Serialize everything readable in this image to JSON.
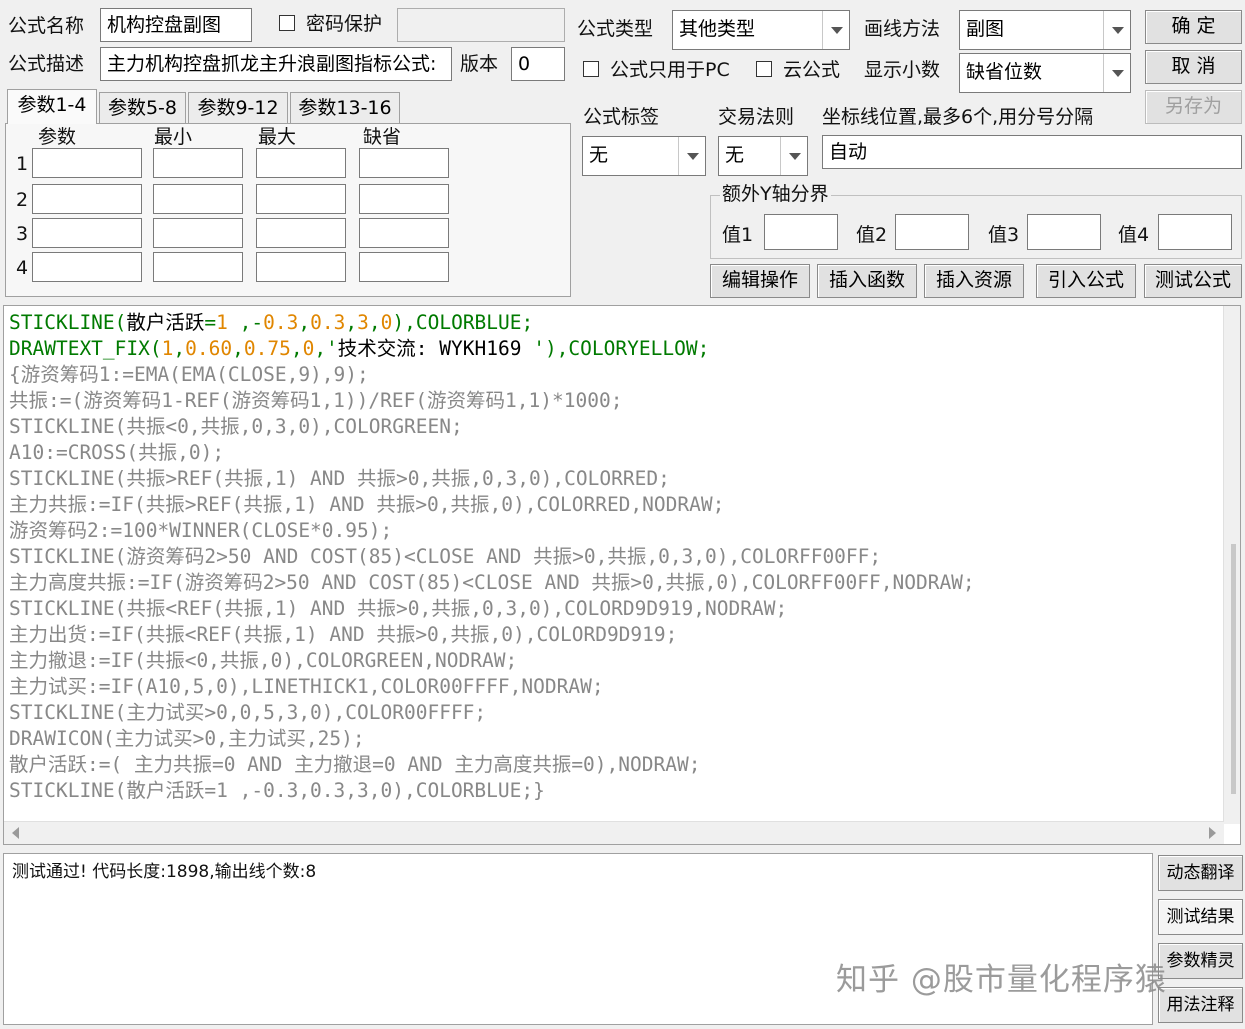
{
  "header": {
    "name_label": "公式名称",
    "name_value": "机构控盘副图",
    "password_label": "密码保护",
    "desc_label": "公式描述",
    "desc_value": "主力机构控盘抓龙主升浪副图指标公式:",
    "version_label": "版本",
    "version_value": "0",
    "type_label": "公式类型",
    "type_value": "其他类型",
    "draw_label": "画线方法",
    "draw_value": "副图",
    "pc_only_label": "公式只用于PC",
    "cloud_label": "云公式",
    "decimals_label": "显示小数",
    "decimals_value": "缺省位数"
  },
  "buttons": {
    "ok": "确 定",
    "cancel": "取 消",
    "save_as": "另存为",
    "edit_ops": "编辑操作",
    "insert_func": "插入函数",
    "insert_res": "插入资源",
    "import": "引入公式",
    "test": "测试公式",
    "dyn_translate": "动态翻译",
    "test_result": "测试结果",
    "param_wizard": "参数精灵",
    "usage_notes": "用法注释"
  },
  "params": {
    "tabs": [
      "参数1-4",
      "参数5-8",
      "参数9-12",
      "参数13-16"
    ],
    "headers": [
      "参数",
      "最小",
      "最大",
      "缺省"
    ],
    "rows": [
      "1",
      "2",
      "3",
      "4"
    ]
  },
  "options": {
    "tag_label": "公式标签",
    "tag_value": "无",
    "rule_label": "交易法则",
    "rule_value": "无",
    "axis_label": "坐标线位置,最多6个,用分号分隔",
    "axis_value": "自动",
    "yaxis_group": "额外Y轴分界",
    "yvals": [
      "值1",
      "值2",
      "值3",
      "值4"
    ]
  },
  "code_lines": [
    [
      [
        "g",
        "STICKLINE("
      ],
      [
        "s",
        "散户活跃"
      ],
      [
        "g",
        "="
      ],
      [
        "n",
        "1"
      ],
      [
        "g",
        " ,-"
      ],
      [
        "n",
        "0.3"
      ],
      [
        "g",
        ","
      ],
      [
        "n",
        "0.3"
      ],
      [
        "g",
        ","
      ],
      [
        "n",
        "3"
      ],
      [
        "g",
        ","
      ],
      [
        "n",
        "0"
      ],
      [
        "g",
        "),COLORBLUE;"
      ]
    ],
    [
      [
        "g",
        "DRAWTEXT_FIX("
      ],
      [
        "n",
        "1"
      ],
      [
        "g",
        ","
      ],
      [
        "n",
        "0.60"
      ],
      [
        "g",
        ","
      ],
      [
        "n",
        "0.75"
      ],
      [
        "g",
        ","
      ],
      [
        "n",
        "0"
      ],
      [
        "g",
        ",'"
      ],
      [
        "s",
        "技术交流: WYKH169 "
      ],
      [
        "g",
        "'),COLORYELLOW;"
      ]
    ],
    [
      [
        "k",
        "{游资筹码1:=EMA(EMA(CLOSE,9),9);"
      ]
    ],
    [
      [
        "k",
        "共振:=(游资筹码1-REF(游资筹码1,1))/REF(游资筹码1,1)*1000;"
      ]
    ],
    [
      [
        "k",
        "STICKLINE(共振<0,共振,0,3,0),COLORGREEN;"
      ]
    ],
    [
      [
        "k",
        "A10:=CROSS(共振,0);"
      ]
    ],
    [
      [
        "k",
        "STICKLINE(共振>REF(共振,1) AND 共振>0,共振,0,3,0),COLORRED;"
      ]
    ],
    [
      [
        "k",
        "主力共振:=IF(共振>REF(共振,1) AND 共振>0,共振,0),COLORRED,NODRAW;"
      ]
    ],
    [
      [
        "k",
        "游资筹码2:=100*WINNER(CLOSE*0.95);"
      ]
    ],
    [
      [
        "k",
        "STICKLINE(游资筹码2>50 AND COST(85)<CLOSE AND 共振>0,共振,0,3,0),COLORFF00FF;"
      ]
    ],
    [
      [
        "k",
        "主力高度共振:=IF(游资筹码2>50 AND COST(85)<CLOSE AND 共振>0,共振,0),COLORFF00FF,NODRAW;"
      ]
    ],
    [
      [
        "k",
        "STICKLINE(共振<REF(共振,1) AND 共振>0,共振,0,3,0),COLORD9D919,NODRAW;"
      ]
    ],
    [
      [
        "k",
        "主力出货:=IF(共振<REF(共振,1) AND 共振>0,共振,0),COLORD9D919;"
      ]
    ],
    [
      [
        "k",
        "主力撤退:=IF(共振<0,共振,0),COLORGREEN,NODRAW;"
      ]
    ],
    [
      [
        "k",
        "主力试买:=IF(A10,5,0),LINETHICK1,COLOR00FFFF,NODRAW;"
      ]
    ],
    [
      [
        "k",
        "STICKLINE(主力试买>0,0,5,3,0),COLOR00FFFF;"
      ]
    ],
    [
      [
        "k",
        "DRAWICON(主力试买>0,主力试买,25);"
      ]
    ],
    [
      [
        "k",
        "散户活跃:=( 主力共振=0 AND 主力撤退=0 AND 主力高度共振=0),NODRAW;"
      ]
    ],
    [
      [
        "k",
        "STICKLINE(散户活跃=1 ,-0.3,0.3,3,0),COLORBLUE;}"
      ]
    ]
  ],
  "output": {
    "message": "测试通过! 代码长度:1898,输出线个数:8"
  },
  "watermark": "知乎 @股市量化程序猿"
}
